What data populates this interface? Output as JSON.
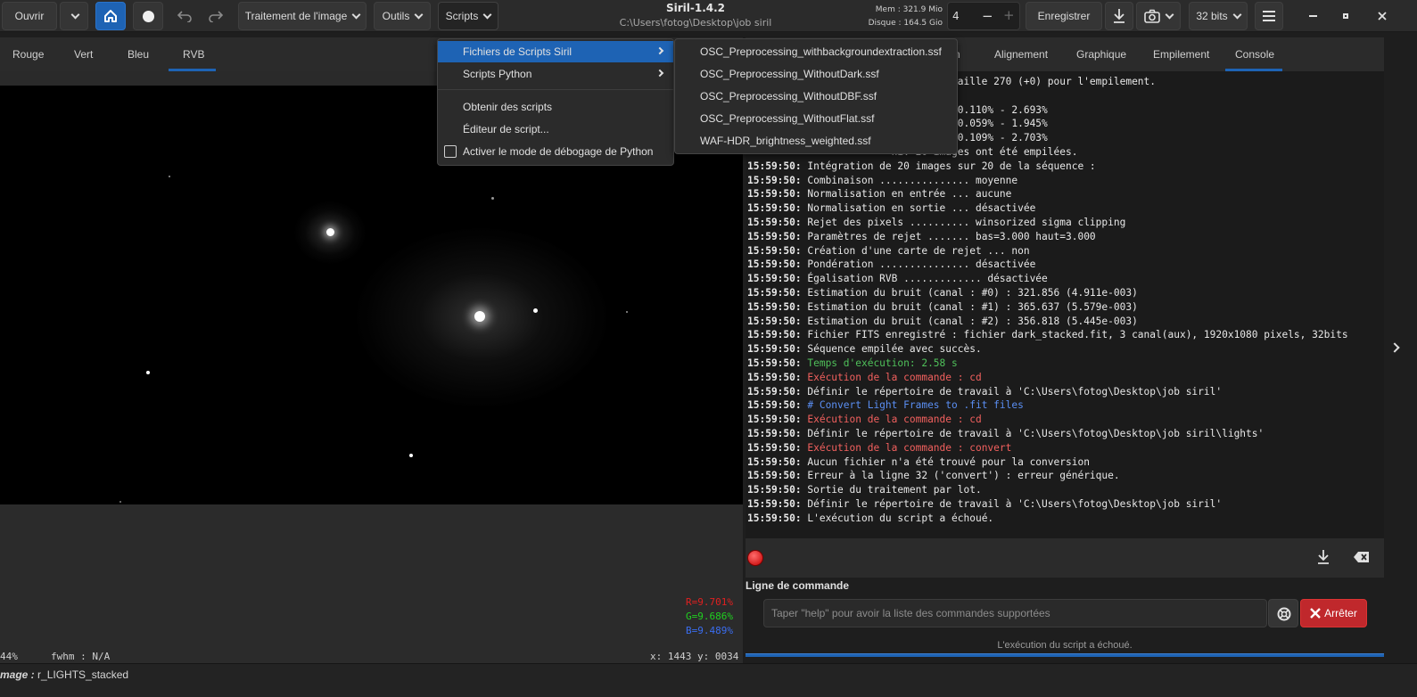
{
  "toolbar": {
    "open_label": "Ouvrir",
    "image_processing_label": "Traitement de l'image",
    "tools_label": "Outils",
    "scripts_label": "Scripts",
    "save_label": "Enregistrer",
    "bitdepth_label": "32 bits",
    "spin_value": "4"
  },
  "window": {
    "title": "Siril-1.4.2",
    "path": "C:\\Users\\fotog\\Desktop\\job siril",
    "mem": "Mem : 321.9 Mio",
    "disk": "Disque : 164.5 Gio"
  },
  "left_tabs": [
    "Rouge",
    "Vert",
    "Bleu",
    "RVB"
  ],
  "right_tabs": [
    "n",
    "Alignement",
    "Graphique",
    "Empilement",
    "Console"
  ],
  "scripts_menu": {
    "items": [
      {
        "label": "Fichiers de Scripts Siril",
        "has_submenu": true,
        "active": true
      },
      {
        "label": "Scripts Python",
        "has_submenu": true
      },
      {
        "label": "Obtenir des scripts"
      },
      {
        "label": "Éditeur de script..."
      },
      {
        "label": "Activer le mode de débogage de Python",
        "checkbox": true,
        "checked": false
      }
    ]
  },
  "scripts_submenu": {
    "items": [
      "OSC_Preprocessing_withbackgroundextraction.ssf",
      "OSC_Preprocessing_WithoutDark.ssf",
      "OSC_Preprocessing_WithoutDBF.ssf",
      "OSC_Preprocessing_WithoutFlat.ssf",
      "WAF-HDR_brightness_weighted.ssf"
    ]
  },
  "console": {
    "lines": [
      {
        "ts": "",
        "text": "                        llèles de taille 270 (+0) pour l'empilement.",
        "color": "txt"
      },
      {
        "ts": "",
        "text": "",
        "color": "txt"
      },
      {
        "ts": "",
        "text": "                        canal #0 : 0.110% - 2.693%",
        "color": "txt"
      },
      {
        "ts": "",
        "text": "                        canal #1 : 0.059% - 1.945%",
        "color": "txt"
      },
      {
        "ts": "",
        "text": "                        canal #2 : 0.109% - 2.703%",
        "color": "txt"
      },
      {
        "ts": "",
        "text": "                        ni. 20 images ont été empilées.",
        "color": "txt"
      },
      {
        "ts": "15:59:50:",
        "text": " Intégration de 20 images sur 20 de la séquence :",
        "color": "txt"
      },
      {
        "ts": "15:59:50:",
        "text": " Combinaison ............... moyenne",
        "color": "txt"
      },
      {
        "ts": "15:59:50:",
        "text": " Normalisation en entrée ... aucune",
        "color": "txt"
      },
      {
        "ts": "15:59:50:",
        "text": " Normalisation en sortie ... désactivée",
        "color": "txt"
      },
      {
        "ts": "15:59:50:",
        "text": " Rejet des pixels .......... winsorized sigma clipping",
        "color": "txt"
      },
      {
        "ts": "15:59:50:",
        "text": " Paramètres de rejet ....... bas=3.000 haut=3.000",
        "color": "txt"
      },
      {
        "ts": "15:59:50:",
        "text": " Création d'une carte de rejet ... non",
        "color": "txt"
      },
      {
        "ts": "15:59:50:",
        "text": " Pondération ............... désactivée",
        "color": "txt"
      },
      {
        "ts": "15:59:50:",
        "text": " Égalisation RVB ............. désactivée",
        "color": "txt"
      },
      {
        "ts": "15:59:50:",
        "text": " Estimation du bruit (canal : #0) : 321.856 (4.911e-003)",
        "color": "txt"
      },
      {
        "ts": "15:59:50:",
        "text": " Estimation du bruit (canal : #1) : 365.637 (5.579e-003)",
        "color": "txt"
      },
      {
        "ts": "15:59:50:",
        "text": " Estimation du bruit (canal : #2) : 356.818 (5.445e-003)",
        "color": "txt"
      },
      {
        "ts": "15:59:50:",
        "text": " Fichier FITS enregistré : fichier dark_stacked.fit, 3 canal(aux), 1920x1080 pixels, 32bits",
        "color": "txt"
      },
      {
        "ts": "15:59:50:",
        "text": " Séquence empilée avec succès.",
        "color": "txt"
      },
      {
        "ts": "15:59:50:",
        "text": " Temps d'exécution: 2.58 s",
        "color": "green"
      },
      {
        "ts": "15:59:50:",
        "text": " Exécution de la commande : cd",
        "color": "red"
      },
      {
        "ts": "15:59:50:",
        "text": " Définir le répertoire de travail à 'C:\\Users\\fotog\\Desktop\\job siril'",
        "color": "txt"
      },
      {
        "ts": "15:59:50:",
        "text": " # Convert Light Frames to .fit files",
        "color": "blue"
      },
      {
        "ts": "15:59:50:",
        "text": " Exécution de la commande : cd",
        "color": "red"
      },
      {
        "ts": "15:59:50:",
        "text": " Définir le répertoire de travail à 'C:\\Users\\fotog\\Desktop\\job siril\\lights'",
        "color": "txt"
      },
      {
        "ts": "15:59:50:",
        "text": " Exécution de la commande : convert",
        "color": "red"
      },
      {
        "ts": "15:59:50:",
        "text": " Aucun fichier n'a été trouvé pour la conversion",
        "color": "txt"
      },
      {
        "ts": "15:59:50:",
        "text": " Erreur à la ligne 32 ('convert') : erreur générique.",
        "color": "txt"
      },
      {
        "ts": "15:59:50:",
        "text": " Sortie du traitement par lot.",
        "color": "txt"
      },
      {
        "ts": "15:59:50:",
        "text": " Définir le répertoire de travail à 'C:\\Users\\fotog\\Desktop\\job siril'",
        "color": "txt"
      },
      {
        "ts": "15:59:50:",
        "text": " L'exécution du script a échoué.",
        "color": "txt"
      }
    ]
  },
  "command": {
    "label": "Ligne de commande",
    "placeholder": "Taper \"help\" pour avoir la liste des commandes supportées",
    "stop_label": "Arrêter",
    "status": "L'exécution du script a échoué."
  },
  "image_info": {
    "r": "R=9.701%",
    "g": "G=9.686%",
    "b": "B=9.489%",
    "zoom": " 44%",
    "fwhm": "fwhm : N/A",
    "coords": "x: 1443 y: 0034",
    "name_label": "mage :",
    "name_value": " r_LIGHTS_stacked"
  },
  "colors": {
    "accent": "#1e63b4",
    "stop": "#c0282c",
    "console_red": "#f2605e",
    "console_green": "#4fc05a",
    "console_blue": "#5a8ef2"
  }
}
